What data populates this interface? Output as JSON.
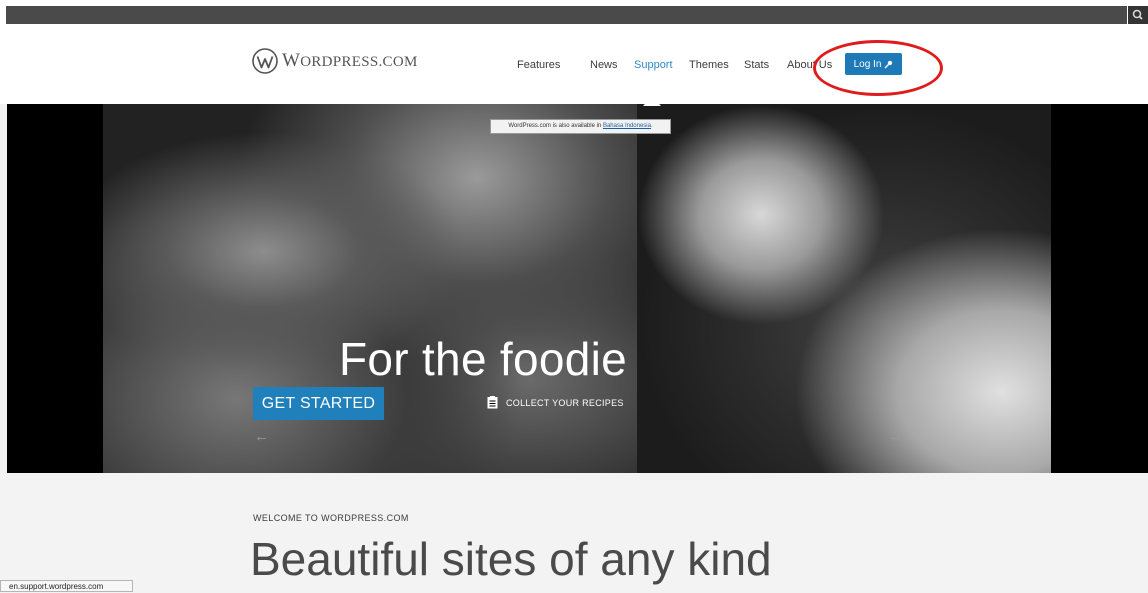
{
  "header": {
    "logo_text_prefix": "W",
    "logo_text": "ORDPRESS.COM",
    "nav": [
      {
        "label": "Features"
      },
      {
        "label": "News"
      },
      {
        "label": "Support"
      },
      {
        "label": "Themes"
      },
      {
        "label": "Stats"
      },
      {
        "label": "About Us"
      }
    ],
    "login_label": "Log In",
    "accent_color": "#1d7ab7",
    "active_nav_color": "#2d8ac7",
    "highlight_color": "#e01b1b"
  },
  "hero": {
    "language_note_prefix": "WordPress.com is also available in ",
    "language_note_link": "Bahasa Indonesia",
    "language_note_suffix": ".",
    "title": "For the foodie",
    "cta_label": "GET STARTED",
    "collect_label": "COLLECT YOUR RECIPES",
    "prev_arrow": "←",
    "next_arrow": "→"
  },
  "welcome": {
    "eyebrow": "WELCOME TO WORDPRESS.COM",
    "headline": "Beautiful sites of any kind"
  },
  "status_bar": {
    "url": "en.support.wordpress.com"
  }
}
